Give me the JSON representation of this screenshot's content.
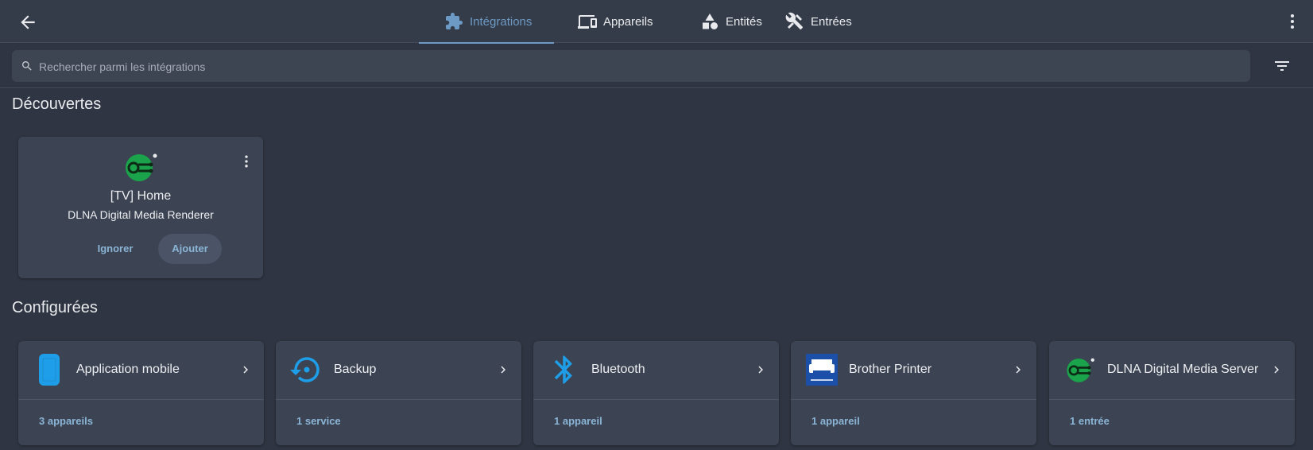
{
  "header": {
    "tabs": [
      {
        "label": "Intégrations",
        "icon": "puzzle-icon",
        "active": true
      },
      {
        "label": "Appareils",
        "icon": "devices-icon",
        "active": false
      },
      {
        "label": "Entités",
        "icon": "shapes-icon",
        "active": false
      },
      {
        "label": "Entrées",
        "icon": "tools-icon",
        "active": false
      }
    ]
  },
  "search": {
    "placeholder": "Rechercher parmi les intégrations",
    "value": ""
  },
  "discovered": {
    "title": "Découvertes",
    "card": {
      "name": "[TV] Home",
      "subtitle": "DLNA Digital Media Renderer",
      "ignore_label": "Ignorer",
      "add_label": "Ajouter",
      "logo_icon": "dlna-logo-icon"
    }
  },
  "configured": {
    "title": "Configurées",
    "cards": [
      {
        "name": "Application mobile",
        "link": "3 appareils",
        "icon": "phone-icon"
      },
      {
        "name": "Backup",
        "link": "1 service",
        "icon": "backup-restore-icon"
      },
      {
        "name": "Bluetooth",
        "link": "1 appareil",
        "icon": "bluetooth-icon"
      },
      {
        "name": "Brother Printer",
        "link": "1 appareil",
        "icon": "brother-logo-icon"
      },
      {
        "name": "DLNA Digital Media Server",
        "link": "1 entrée",
        "icon": "dlna-logo-icon"
      }
    ]
  },
  "colors": {
    "background": "#2f3542",
    "card": "#3c4352",
    "accent": "#6d9ac4",
    "link": "#8bb5d6",
    "dlna_green": "#1aa34a",
    "bluetooth_blue": "#1e9ee8"
  }
}
